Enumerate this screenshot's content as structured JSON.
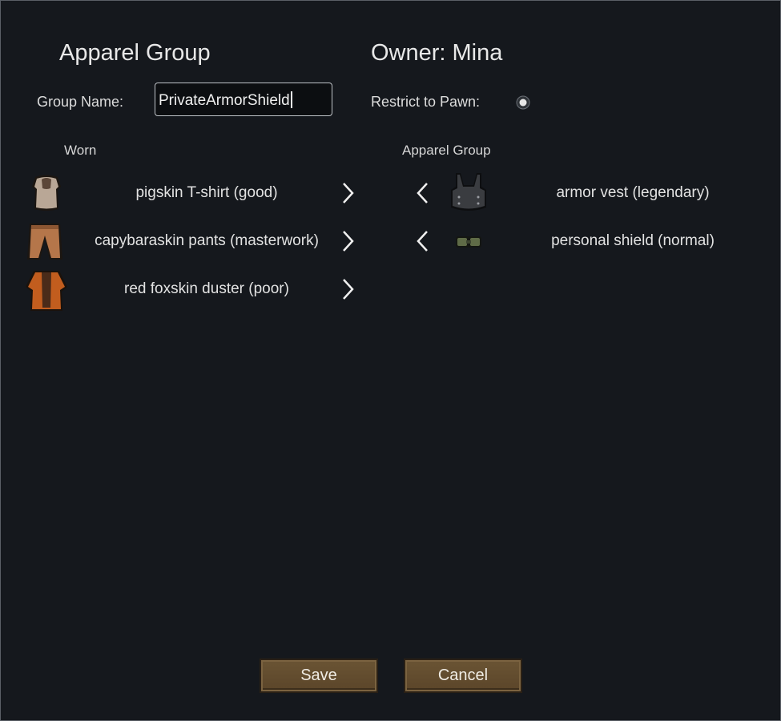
{
  "dialog": {
    "title": "Apparel Group",
    "owner_text": "Owner: Mina",
    "group_name_label": "Group Name:",
    "group_name_value": "PrivateArmorShield",
    "restrict_label": "Restrict to Pawn:",
    "restrict_checked": true
  },
  "worn": {
    "header": "Worn",
    "items": [
      {
        "label": "pigskin T-shirt (good)",
        "icon": "tshirt-icon",
        "color": "#b9a796"
      },
      {
        "label": "capybaraskin pants (masterwork)",
        "icon": "pants-icon",
        "color": "#b5764a"
      },
      {
        "label": "red foxskin duster (poor)",
        "icon": "duster-icon",
        "color": "#c25d1e"
      }
    ]
  },
  "group": {
    "header": "Apparel Group",
    "items": [
      {
        "label": "armor vest (legendary)",
        "icon": "armor-vest-icon",
        "color": "#3a3c40"
      },
      {
        "label": "personal shield (normal)",
        "icon": "shield-belt-icon",
        "color": "#5f6b47"
      }
    ]
  },
  "buttons": {
    "save": "Save",
    "cancel": "Cancel"
  },
  "colors": {
    "background": "#15181d",
    "button": "#5f4a2c"
  }
}
